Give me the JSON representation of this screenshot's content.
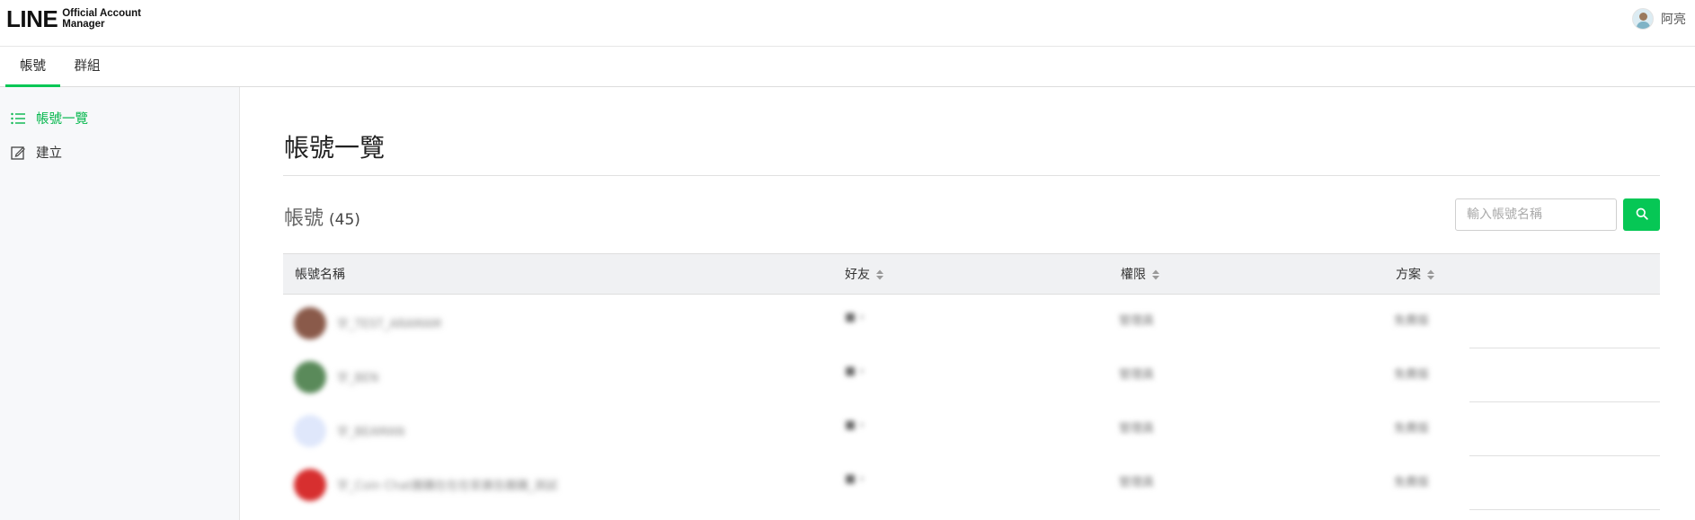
{
  "header": {
    "logo_main": "LINE",
    "logo_sub_line1": "Official Account",
    "logo_sub_line2": "Manager",
    "user_name": "阿亮"
  },
  "tabs": [
    {
      "label": "帳號",
      "active": true
    },
    {
      "label": "群組",
      "active": false
    }
  ],
  "sidebar": {
    "items": [
      {
        "label": "帳號一覽",
        "icon": "list-icon",
        "active": true
      },
      {
        "label": "建立",
        "icon": "edit-icon",
        "active": false
      }
    ]
  },
  "main": {
    "title": "帳號一覽",
    "section_label": "帳號",
    "section_count": "(45)",
    "search": {
      "placeholder": "輸入帳號名稱",
      "value": ""
    },
    "columns": {
      "name": "帳號名稱",
      "friends": "好友",
      "role": "權限",
      "plan": "方案"
    },
    "rows": [
      {
        "name": "宇_TEST_ARAMAM",
        "friends": "■ ›",
        "role": "管理員",
        "plan": "免費版",
        "avatar_color": "#8a5a4a"
      },
      {
        "name": "宇_BEN",
        "friends": "■ ›",
        "role": "管理員",
        "plan": "免費版",
        "avatar_color": "#5a8a5a"
      },
      {
        "name": "宇_BEAMAN",
        "friends": "■ ›",
        "role": "管理員",
        "plan": "免費版",
        "avatar_color": "#dfe7fb"
      },
      {
        "name": "宇_Coin Chat團購在在在家廣告團購_測試",
        "friends": "■ ›",
        "role": "管理員",
        "plan": "免費版",
        "avatar_color": "#d72f2f"
      }
    ]
  },
  "colors": {
    "accent": "#06c755"
  }
}
